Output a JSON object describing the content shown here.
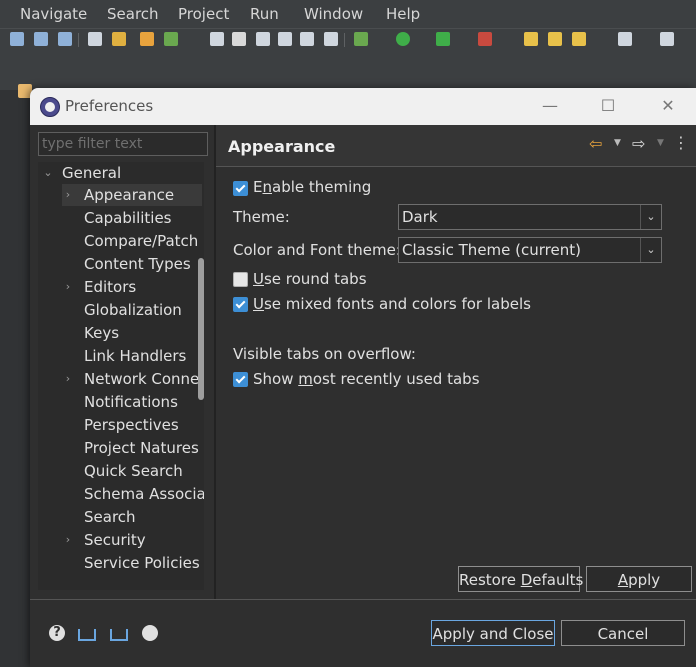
{
  "menubar": {
    "items": [
      "Navigate",
      "Search",
      "Project",
      "Run",
      "Window",
      "Help"
    ]
  },
  "colors": {
    "ide_background": "#3c3f41",
    "dialog_background": "#2f2f2f",
    "titlebar": "#f0f0f0",
    "checkbox_checked": "#3d8fd6",
    "nav_arrow": "#e8a33d"
  },
  "dialog": {
    "title": "Preferences",
    "window_controls": {
      "minimize": "—",
      "maximize": "☐",
      "close": "✕"
    }
  },
  "filter": {
    "placeholder": "type filter text",
    "value": ""
  },
  "tree": {
    "root": {
      "label": "General",
      "expanded": true
    },
    "items": [
      {
        "label": "Appearance",
        "has_children": true,
        "selected": true
      },
      {
        "label": "Capabilities",
        "has_children": false
      },
      {
        "label": "Compare/Patch",
        "has_children": false
      },
      {
        "label": "Content Types",
        "has_children": false
      },
      {
        "label": "Editors",
        "has_children": true
      },
      {
        "label": "Globalization",
        "has_children": false
      },
      {
        "label": "Keys",
        "has_children": false
      },
      {
        "label": "Link Handlers",
        "has_children": false
      },
      {
        "label": "Network Connections",
        "has_children": true
      },
      {
        "label": "Notifications",
        "has_children": false
      },
      {
        "label": "Perspectives",
        "has_children": false
      },
      {
        "label": "Project Natures",
        "has_children": false
      },
      {
        "label": "Quick Search",
        "has_children": false
      },
      {
        "label": "Schema Associations",
        "has_children": false
      },
      {
        "label": "Search",
        "has_children": false
      },
      {
        "label": "Security",
        "has_children": true
      },
      {
        "label": "Service Policies",
        "has_children": false
      }
    ]
  },
  "page": {
    "title": "Appearance",
    "enable_theming": {
      "label_pre": "E",
      "label_mnemonic": "n",
      "label_post": "able theming",
      "checked": true
    },
    "theme": {
      "label": "Theme:",
      "value": "Dark"
    },
    "color_font_theme": {
      "label": "Color and Font theme:",
      "value": "Classic Theme (current)"
    },
    "use_round_tabs": {
      "label_mnemonic": "U",
      "label_post": "se round tabs",
      "checked": false
    },
    "use_mixed_fonts": {
      "label_mnemonic": "U",
      "label_post": "se mixed fonts and colors for labels",
      "checked": true
    },
    "visible_tabs_heading": "Visible tabs on overflow:",
    "show_mru_tabs": {
      "label_pre": "Show ",
      "label_mnemonic": "m",
      "label_post": "ost recently used tabs",
      "checked": true
    }
  },
  "buttons": {
    "restore_defaults": {
      "pre": "Restore ",
      "mnemonic": "D",
      "post": "efaults"
    },
    "apply": {
      "mnemonic": "A",
      "post": "pply"
    },
    "apply_and_close": "Apply and Close",
    "cancel": "Cancel"
  },
  "icons": {
    "help": "?",
    "tree_expanded": "⌄",
    "tree_collapsed": "›",
    "combo_arrow": "⌄",
    "nav_back": "⇦",
    "nav_forward": "⇨",
    "nav_dropdown": "▼",
    "view_menu": "⋮"
  }
}
